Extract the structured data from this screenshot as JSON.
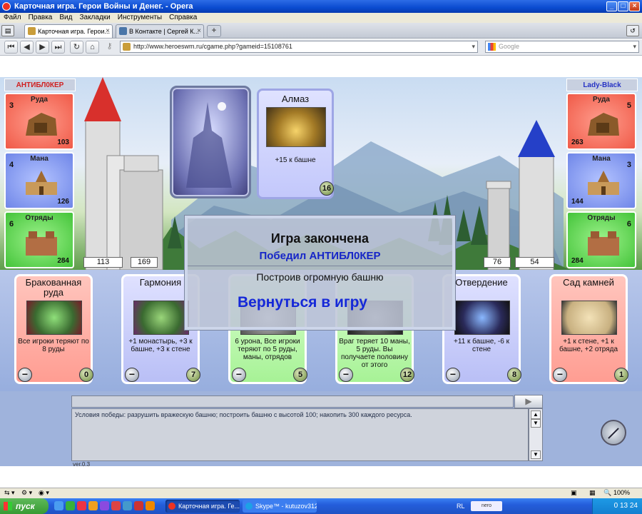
{
  "window": {
    "title": "Карточная игра. Герои Войны и Денег. - Opera"
  },
  "menu": [
    "Файл",
    "Правка",
    "Вид",
    "Закладки",
    "Инструменты",
    "Справка"
  ],
  "tabs": [
    {
      "label": "Карточная игра. Герои..."
    },
    {
      "label": "В Контакте | Сергей К..."
    }
  ],
  "address": {
    "url": "http://www.heroeswm.ru/cgame.php?gameid=15108761",
    "search_placeholder": "Google"
  },
  "players": {
    "left": {
      "name": "АНТИБЛ0КЕР",
      "resources": [
        {
          "name": "Руда",
          "production": "3",
          "stock": "103"
        },
        {
          "name": "Мана",
          "production": "4",
          "stock": "126"
        },
        {
          "name": "Отряды",
          "production": "6",
          "stock": "284"
        }
      ],
      "tower": "113",
      "wall": "169"
    },
    "right": {
      "name": "Lady-Black",
      "resources": [
        {
          "name": "Руда",
          "production": "5",
          "stock": "263"
        },
        {
          "name": "Мана",
          "production": "3",
          "stock": "144"
        },
        {
          "name": "Отряды",
          "production": "6",
          "stock": "284"
        }
      ],
      "tower": "54",
      "wall": "76"
    }
  },
  "played_card": {
    "title": "Алмаз",
    "desc": "+15 к башне",
    "cost": "16"
  },
  "hand": [
    {
      "title": "Бракованная руда",
      "desc": "Все игроки теряют по 8 руды",
      "cost": "0",
      "color": "red"
    },
    {
      "title": "Гармония",
      "desc": "+1 монастырь, +3 к башне, +3 к стене",
      "cost": "7",
      "color": "blue"
    },
    {
      "title": "",
      "desc": "6 урона, Все игроки теряют по 5 руды, маны, отрядов",
      "cost": "5",
      "color": "green"
    },
    {
      "title": "",
      "desc": "Враг теряет 10 маны, 5 руды. Вы получаете половину от этого",
      "cost": "12",
      "color": "green"
    },
    {
      "title": "Отвердение",
      "desc": "+11 к башне, -6 к стене",
      "cost": "8",
      "color": "blue"
    },
    {
      "title": "Сад камней",
      "desc": "+1 к стене, +1 к башне, +2 отряда",
      "cost": "1",
      "color": "red"
    }
  ],
  "modal": {
    "title": "Игра закончена",
    "winner": "Победил АНТИБЛ0КЕР",
    "reason": "Построив огромную башню",
    "back_button": "Вернуться в игру"
  },
  "log": {
    "text": "Условия победы: разрушить вражескую башню; построить башню с высотой 100; накопить 300 каждого ресурса.",
    "version": "ver.0.3"
  },
  "statusbar": {
    "zoom": "100%"
  },
  "taskbar": {
    "start": "пуск",
    "tasks": [
      "Карточная игра. Ге...",
      "Skype™ - kutuzov312"
    ],
    "lang": "RL",
    "clock": "0 13 24"
  }
}
